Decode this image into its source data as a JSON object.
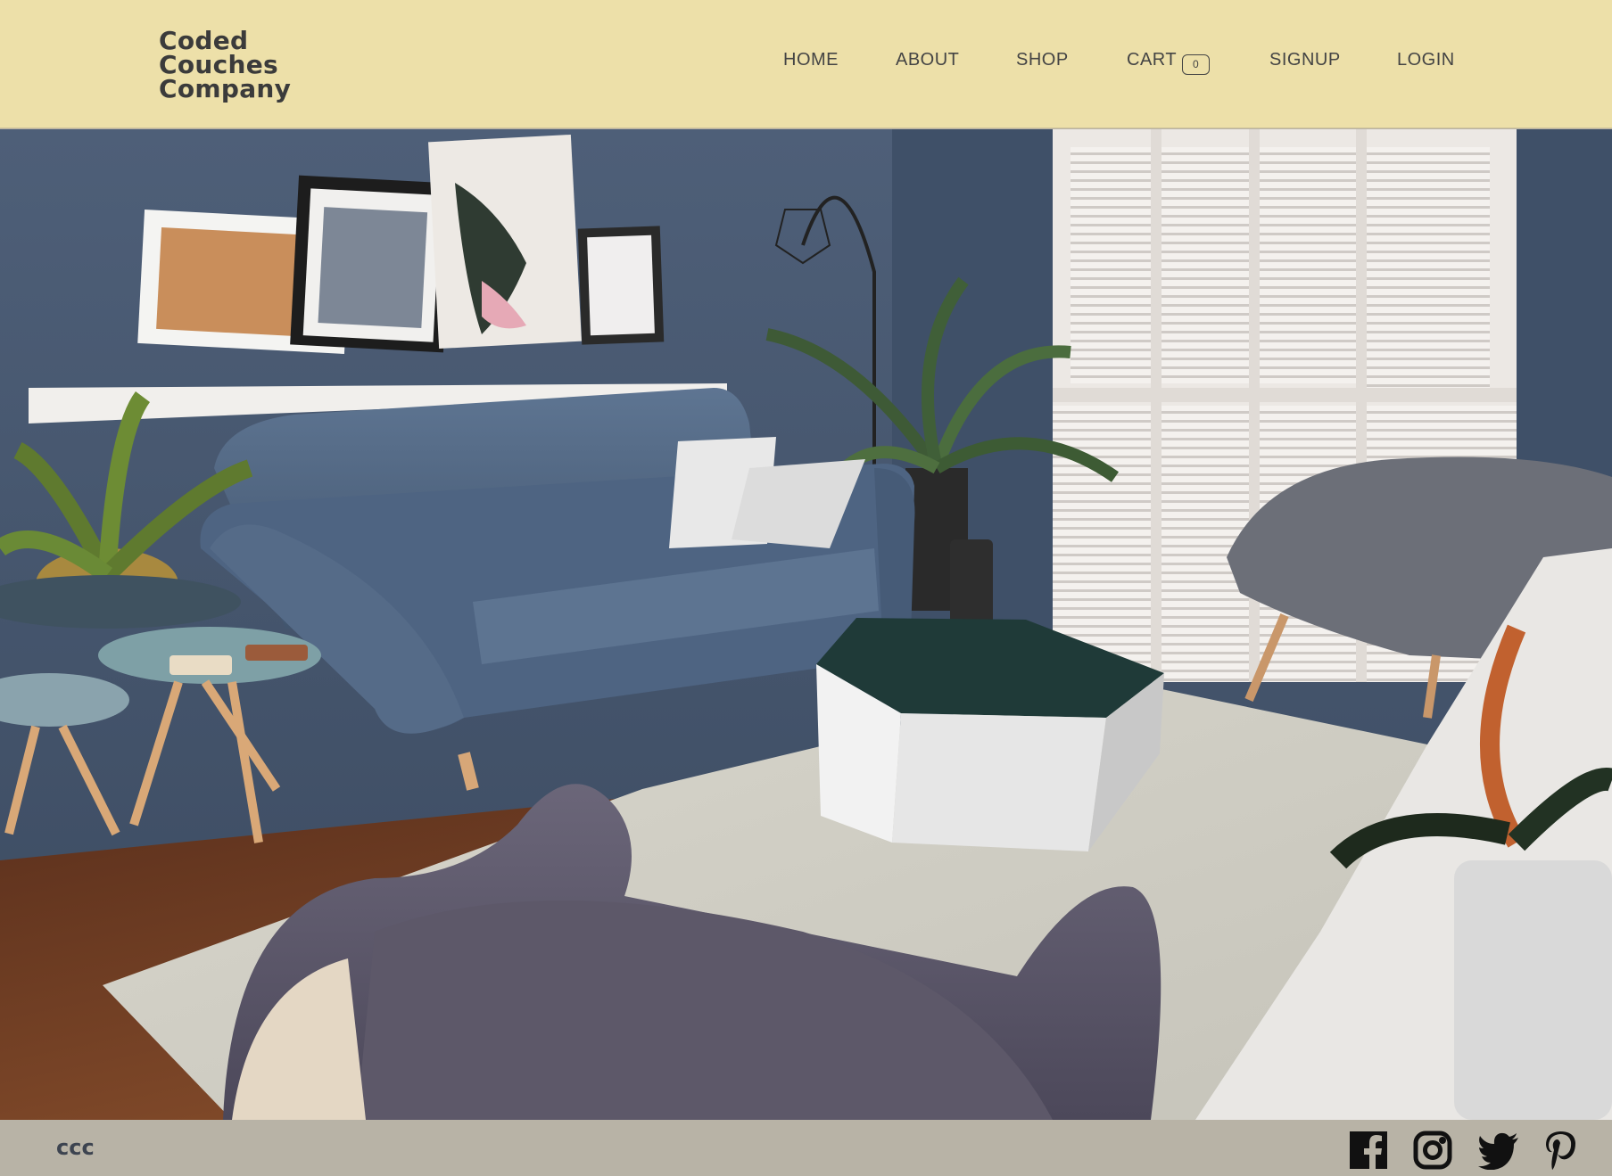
{
  "brand": {
    "logo_line1": "Coded",
    "logo_line2": "Couches",
    "logo_line3": "Company"
  },
  "nav": {
    "home": "HOME",
    "about": "ABOUT",
    "shop": "SHOP",
    "cart": "CART",
    "cart_count": "0",
    "signup": "SIGNUP",
    "login": "LOGIN"
  },
  "hero": {
    "image_subject": "living room with blue sofa, armchairs, hexagonal coffee table, plants and framed pictures"
  },
  "footer": {
    "copyright": "ccc",
    "social_icons": [
      "facebook-icon",
      "instagram-icon",
      "twitter-icon",
      "pinterest-icon"
    ]
  },
  "colors": {
    "header_bg": "#ede0a9",
    "footer_bg": "#b8b3a6",
    "nav_text": "#444444",
    "wall": "#4a5a72"
  }
}
